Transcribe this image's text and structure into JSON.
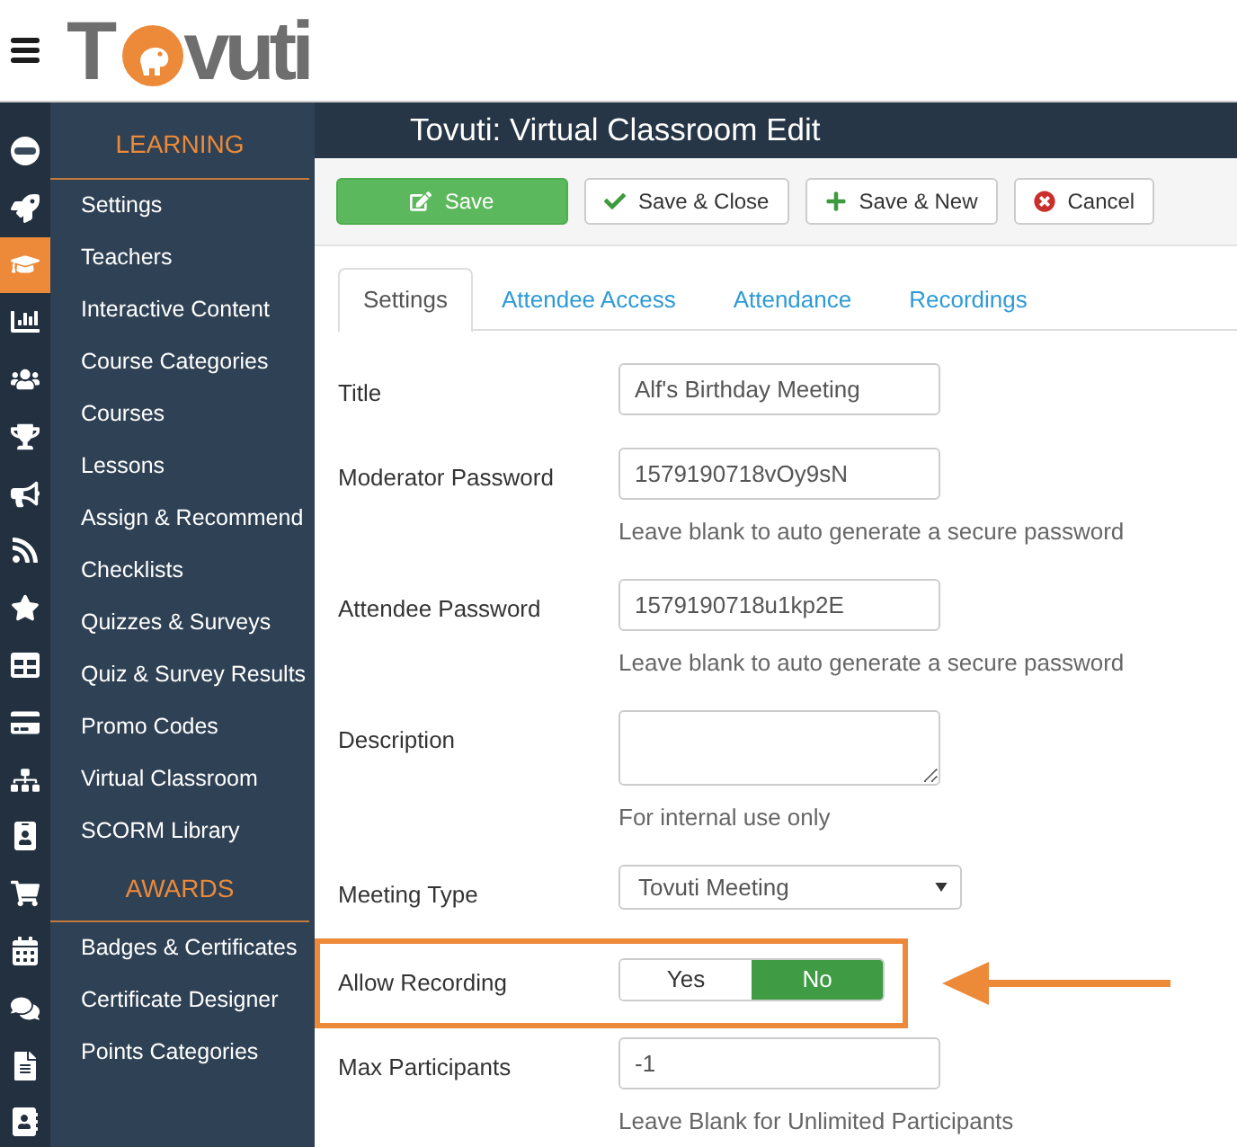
{
  "header": {
    "logo": {
      "before_mark": "T",
      "after_mark": "vuti"
    }
  },
  "rail": [
    {
      "selected": false
    },
    {
      "selected": false
    },
    {
      "selected": true
    },
    {
      "selected": false
    },
    {
      "selected": false
    },
    {
      "selected": false
    },
    {
      "selected": false
    },
    {
      "selected": false
    },
    {
      "selected": false
    },
    {
      "selected": false
    },
    {
      "selected": false
    },
    {
      "selected": false
    },
    {
      "selected": false
    },
    {
      "selected": false
    },
    {
      "selected": false
    },
    {
      "selected": false
    },
    {
      "selected": false
    },
    {
      "selected": false
    }
  ],
  "sidebar": {
    "sections": [
      {
        "heading": "LEARNING",
        "items": [
          "Settings",
          "Teachers",
          "Interactive Content",
          "Course Categories",
          "Courses",
          "Lessons",
          "Assign & Recommend",
          "Checklists",
          "Quizzes & Surveys",
          "Quiz & Survey Results",
          "Promo Codes",
          "Virtual Classroom",
          "SCORM Library"
        ]
      },
      {
        "heading": "AWARDS",
        "items": [
          "Badges & Certificates",
          "Certificate Designer",
          "Points Categories"
        ]
      }
    ]
  },
  "page_title": "Tovuti: Virtual Classroom Edit",
  "toolbar": [
    {
      "label": "Save",
      "kind": "primary"
    },
    {
      "label": "Save & Close",
      "kind": "default"
    },
    {
      "label": "Save & New",
      "kind": "default"
    },
    {
      "label": "Cancel",
      "kind": "default"
    }
  ],
  "tabs": [
    {
      "label": "Settings",
      "selected": true
    },
    {
      "label": "Attendee Access",
      "selected": false
    },
    {
      "label": "Attendance",
      "selected": false
    },
    {
      "label": "Recordings",
      "selected": false
    }
  ],
  "fields": [
    {
      "label": "Title",
      "kind": "text",
      "value": "Alf's Birthday Meeting"
    },
    {
      "label": "Moderator Password",
      "kind": "text",
      "value": "1579190718vOy9sN",
      "help": "Leave blank to auto generate a secure password"
    },
    {
      "label": "Attendee Password",
      "kind": "text",
      "value": "1579190718u1kp2E",
      "help": "Leave blank to auto generate a secure password"
    },
    {
      "label": "Description",
      "kind": "textarea",
      "help": "For internal use only"
    },
    {
      "label": "Meeting Type",
      "kind": "select",
      "value": "Tovuti Meeting"
    },
    {
      "label": "Allow Recording",
      "kind": "toggle",
      "highlighted": true,
      "options": [
        {
          "label": "Yes",
          "selected": false
        },
        {
          "label": "No",
          "selected": true
        }
      ]
    },
    {
      "label": "Max Participants",
      "kind": "text",
      "value": "-1",
      "help": "Leave Blank for Unlimited Participants"
    }
  ]
}
